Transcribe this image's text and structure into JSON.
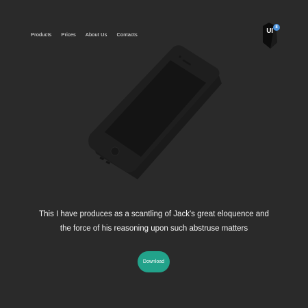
{
  "nav": {
    "items": [
      {
        "label": "Products"
      },
      {
        "label": "Prices"
      },
      {
        "label": "About Us"
      },
      {
        "label": "Contacts"
      }
    ]
  },
  "logo": {
    "text": "UI",
    "badge": "8"
  },
  "hero": {
    "line1": "This I have produces as a scantling of Jack's great eloquence and",
    "line2": "the force of his reasoning upon such abstruse matters"
  },
  "cta": {
    "download_label": "Download"
  },
  "colors": {
    "background": "#2a2a2a",
    "accent": "#22a28a",
    "badge": "#4a90d9"
  },
  "icons": {
    "logo": "hexagon-logo-icon",
    "illustration": "smartphone-illustration"
  }
}
